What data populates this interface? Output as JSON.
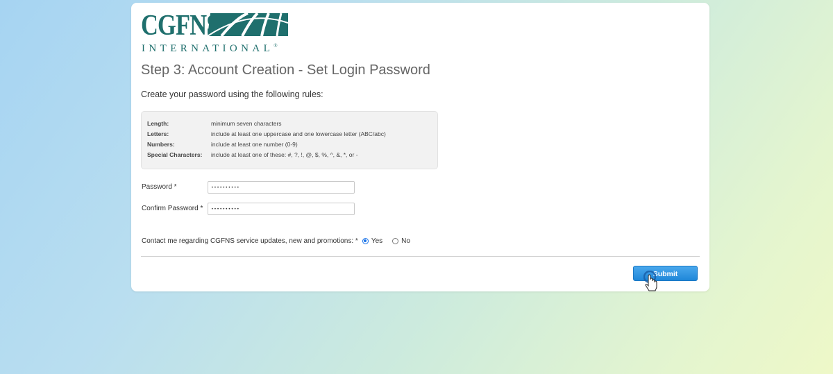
{
  "logo": {
    "brand": "CGFNS",
    "subtitle": "INTERNATIONAL",
    "registered": "®"
  },
  "page": {
    "title": "Step 3: Account Creation - Set Login Password",
    "intro": "Create your password using the following rules:"
  },
  "rules": [
    {
      "label": "Length:",
      "desc": "minimum seven characters"
    },
    {
      "label": "Letters:",
      "desc": "include at least one uppercase and one lowercase letter (ABC/abc)"
    },
    {
      "label": "Numbers:",
      "desc": "include at least one number (0-9)"
    },
    {
      "label": "Special Characters:",
      "desc": "include at least one of these: #, ?, !, @, $, %, ^, &, *, or -"
    }
  ],
  "form": {
    "password_label": "Password *",
    "password_value": "••••••••••",
    "confirm_label": "Confirm Password *",
    "confirm_value": "••••••••••",
    "contact_label": "Contact me regarding CGFNS service updates, new and promotions: *",
    "yes_label": "Yes",
    "no_label": "No",
    "contact_selected": "Yes",
    "submit_label": "Submit"
  },
  "colors": {
    "brand": "#1f6f6d",
    "submit": "#1f87d9",
    "radio_checked": "#1a73e8"
  },
  "icons": {
    "cursor": "hand-pointer-icon"
  }
}
